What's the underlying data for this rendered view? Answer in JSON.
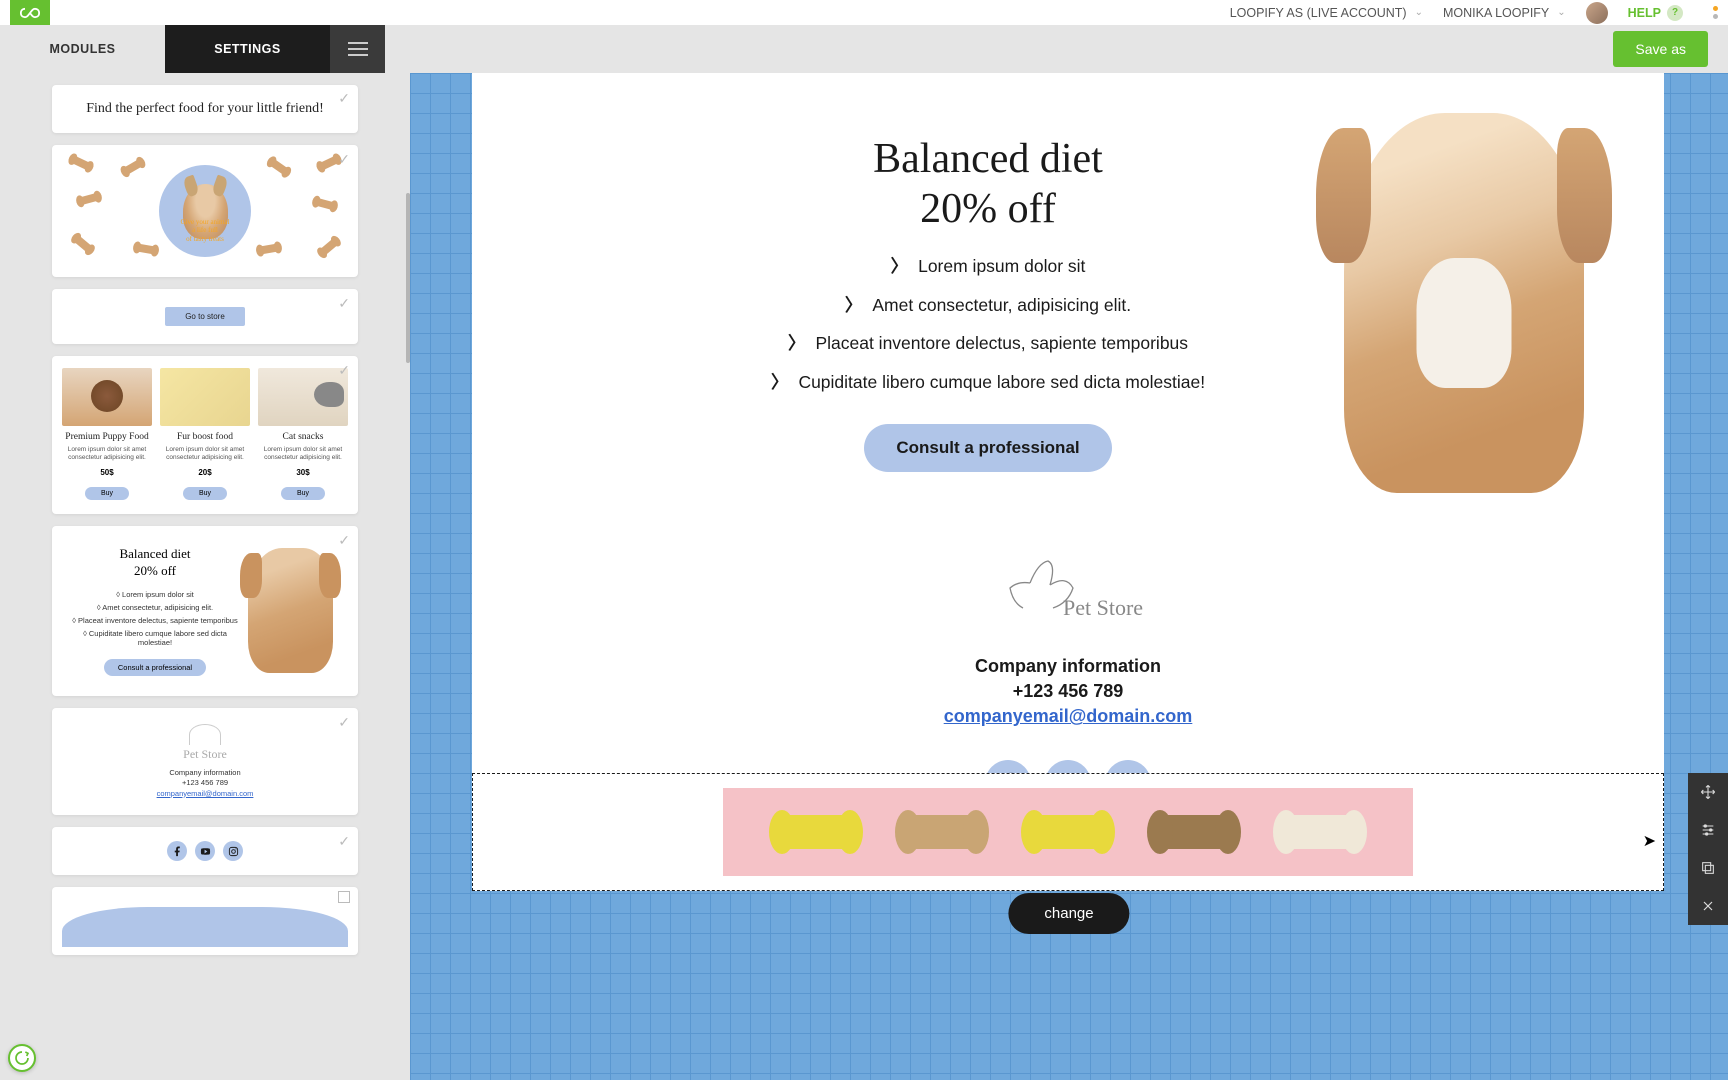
{
  "header": {
    "account": "LOOPIFY AS (LIVE ACCOUNT)",
    "user": "MONIKA LOOPIFY",
    "help": "HELP",
    "help_badge": "?"
  },
  "tabs": {
    "modules": "MODULES",
    "settings": "SETTINGS"
  },
  "save_label": "Save as",
  "sidebar": {
    "m1_text": "Find the perfect food for your little friend!",
    "m3_btn": "Go to store",
    "m4": {
      "cols": [
        {
          "title": "Premium Puppy Food",
          "desc": "Lorem ipsum dolor sit amet consectetur adipisicing elit.",
          "price": "50$",
          "buy": "Buy"
        },
        {
          "title": "Fur boost food",
          "desc": "Lorem ipsum dolor sit amet consectetur adipisicing elit.",
          "price": "20$",
          "buy": "Buy"
        },
        {
          "title": "Cat snacks",
          "desc": "Lorem ipsum dolor sit amet consectetur adipisicing elit.",
          "price": "30$",
          "buy": "Buy"
        }
      ]
    },
    "m5": {
      "heading_line1": "Balanced diet",
      "heading_line2": "20% off",
      "bullets": [
        "Lorem ipsum dolor sit",
        "Amet consectetur, adipisicing elit.",
        "Placeat inventore delectus, sapiente temporibus",
        "Cupiditate libero cumque labore sed dicta molestiae!"
      ],
      "btn": "Consult a professional"
    },
    "m6": {
      "logo": "Pet Store",
      "info": "Company information",
      "phone": "+123 456 789",
      "email": "companyemail@domain.com"
    }
  },
  "canvas": {
    "hero": {
      "title_line1": "Balanced diet",
      "title_line2": "20% off",
      "bullets": [
        "Lorem ipsum dolor sit",
        "Amet consectetur, adipisicing elit.",
        "Placeat inventore delectus, sapiente temporibus",
        "Cupiditate libero cumque labore sed dicta molestiae!"
      ],
      "btn": "Consult a professional"
    },
    "footer": {
      "logo": "Pet Store",
      "info": "Company information",
      "phone": "+123 456 789",
      "email": "companyemail@domain.com"
    },
    "change_label": "change"
  },
  "colors": {
    "brand_green": "#66c030",
    "accent_blue": "#b0c5e8",
    "canvas_grid": "#6fa8dc"
  }
}
